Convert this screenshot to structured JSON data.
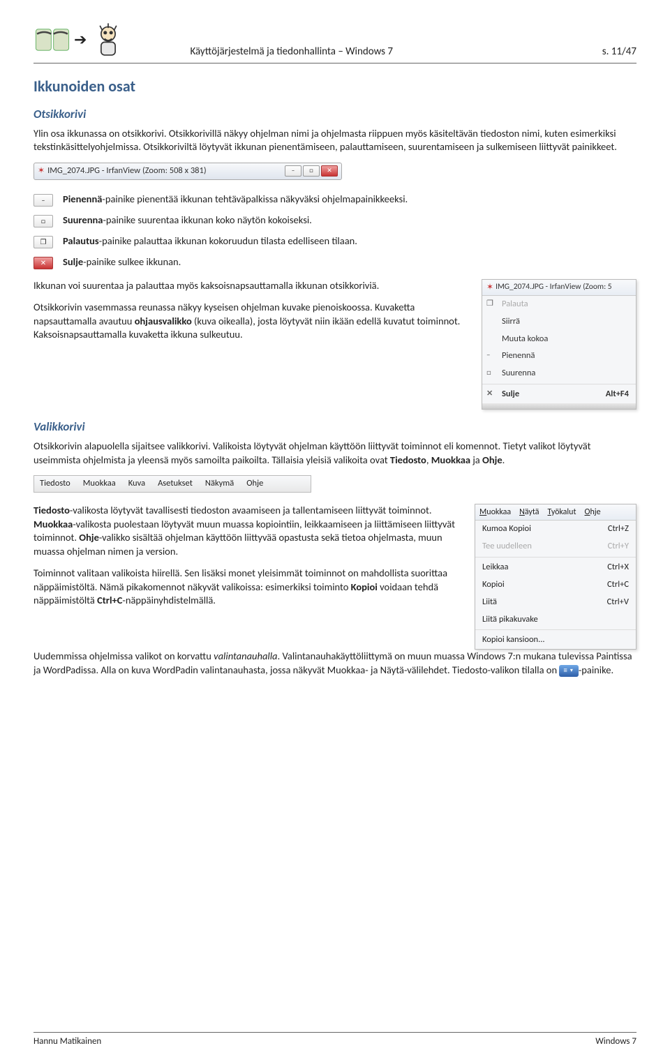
{
  "header": {
    "title": "Käyttöjärjestelmä ja tiedonhallinta – Windows 7",
    "page_indicator": "s. 11/47"
  },
  "section1": {
    "heading": "Ikkunoiden osat",
    "sub1_heading": "Otsikkorivi",
    "para1_a": "Ylin osa ikkunassa on otsikkorivi. Otsikkorivillä näkyy ohjelman nimi ja ohjelmasta riippuen myös käsiteltävän tiedoston nimi, kuten esimerkiksi tekstinkäsittelyohjelmissa. Otsikkoriviltä löytyvät ikkunan pienentämiseen, palauttamiseen, suurentamiseen ja sulkemiseen liittyvät painikkeet.",
    "titlebar_text": "IMG_2074.JPG - IrfanView (Zoom: 508 x 381)",
    "titlebar_min": "–",
    "titlebar_max": "□",
    "titlebar_close": "✕",
    "icon_items": [
      {
        "glyph": "–",
        "close": false,
        "bold": "Pienennä",
        "rest": "-painike pienentää ikkunan tehtäväpalkissa näkyväksi ohjelmapainikkeeksi."
      },
      {
        "glyph": "□",
        "close": false,
        "bold": "Suurenna",
        "rest": "-painike suurentaa ikkunan koko näytön kokoiseksi."
      },
      {
        "glyph": "❐",
        "close": false,
        "bold": "Palautus",
        "rest": "-painike palauttaa ikkunan kokoruudun tilasta edelliseen tilaan."
      },
      {
        "glyph": "✕",
        "close": true,
        "bold": "Sulje",
        "rest": "-painike sulkee ikkunan."
      }
    ],
    "para2": "Ikkunan voi suurentaa ja palauttaa myös kaksoisnapsauttamalla ikkunan otsikkoriviä.",
    "para3_a": "Otsikkorivin vasemmassa reunassa näkyy kyseisen ohjelman kuvake pienoiskoossa. Kuvaketta napsauttamalla avautuu ",
    "para3_bold": "ohjausvalikko",
    "para3_b": " (kuva oikealla), josta löytyvät niin ikään edellä kuvatut toiminnot. Kaksoisnapsauttamalla kuvaketta ikkuna sulkeutuu.",
    "ctx_title": "IMG_2074.JPG - IrfanView (Zoom: 5",
    "ctx_items": [
      {
        "label": "Palauta",
        "icon": "❐",
        "disabled": true
      },
      {
        "label": "Siirrä",
        "icon": "",
        "disabled": false
      },
      {
        "label": "Muuta kokoa",
        "icon": "",
        "disabled": false
      },
      {
        "label": "Pienennä",
        "icon": "–",
        "disabled": false
      },
      {
        "label": "Suurenna",
        "icon": "□",
        "disabled": false
      }
    ],
    "ctx_close": {
      "label": "Sulje",
      "shortcut": "Alt+F4",
      "icon": "✕"
    }
  },
  "section2": {
    "heading": "Valikkorivi",
    "para1_a": "Otsikkorivin alapuolella sijaitsee valikkorivi. Valikoista löytyvät ohjelman käyttöön liittyvät toiminnot eli komennot. Tietyt valikot löytyvät useimmista ohjelmista ja yleensä myös samoilta paikoilta. Tällaisia yleisiä valikoita ovat ",
    "para1_b1": "Tiedosto",
    "para1_b2": "Muokkaa",
    "para1_b3": "Ohje",
    "menubar": [
      "Tiedosto",
      "Muokkaa",
      "Kuva",
      "Asetukset",
      "Näkymä",
      "Ohje"
    ],
    "para2_b1": "Tiedosto",
    "para2_a": "-valikosta löytyvät tavallisesti tiedoston avaamiseen ja tallentamiseen liittyvät toiminnot. ",
    "para2_b2": "Muokkaa",
    "para2_b": "-valikosta puolestaan löytyvät muun muassa kopiointiin, leikkaamiseen ja liittämiseen liittyvät toiminnot. ",
    "para2_b3": "Ohje",
    "para2_c": "-valikko sisältää ohjelman käyttöön liittyvää opastusta sekä tietoa ohjelmasta, muun muassa ohjelman nimen ja version.",
    "para3_a": "Toiminnot valitaan valikoista hiirellä. Sen lisäksi monet yleisimmät toiminnot on mahdollista suorittaa näppäimistöltä. Nämä pikakomennot näkyvät valikoissa: esimerkiksi toiminto ",
    "para3_b1": "Kopioi",
    "para3_b": " voidaan tehdä näppäimistöltä ",
    "para3_b2": "Ctrl+C",
    "para3_c": "-näppäinyhdistelmällä.",
    "edit_head": [
      "Muokkaa",
      "Näytä",
      "Työkalut",
      "Ohje"
    ],
    "edit_rows": [
      {
        "label": "Kumoa Kopioi",
        "shortcut": "Ctrl+Z",
        "disabled": false
      },
      {
        "label": "Tee uudelleen",
        "shortcut": "Ctrl+Y",
        "disabled": true
      },
      {
        "sep": true
      },
      {
        "label": "Leikkaa",
        "shortcut": "Ctrl+X",
        "disabled": false
      },
      {
        "label": "Kopioi",
        "shortcut": "Ctrl+C",
        "disabled": false
      },
      {
        "label": "Liitä",
        "shortcut": "Ctrl+V",
        "disabled": false
      },
      {
        "label": "Liitä pikakuvake",
        "shortcut": "",
        "disabled": false
      },
      {
        "sep": true
      },
      {
        "label": "Kopioi kansioon...",
        "shortcut": "",
        "disabled": false
      }
    ],
    "para4_a": "Uudemmissa ohjelmissa valikot on korvattu ",
    "para4_i": "valintanauhalla",
    "para4_b": ". Valintanauhakäyttöliittymä on muun muassa Windows 7:n mukana tulevissa Paintissa ja WordPadissa. Alla on kuva WordPadin valintanauhasta, jossa näkyvät Muokkaa- ja Näytä-välilehdet. Tiedosto-valikon tilalla on ",
    "para4_chip": "▾",
    "para4_c": "-painike."
  },
  "footer": {
    "author": "Hannu Matikainen",
    "product": "Windows 7"
  }
}
